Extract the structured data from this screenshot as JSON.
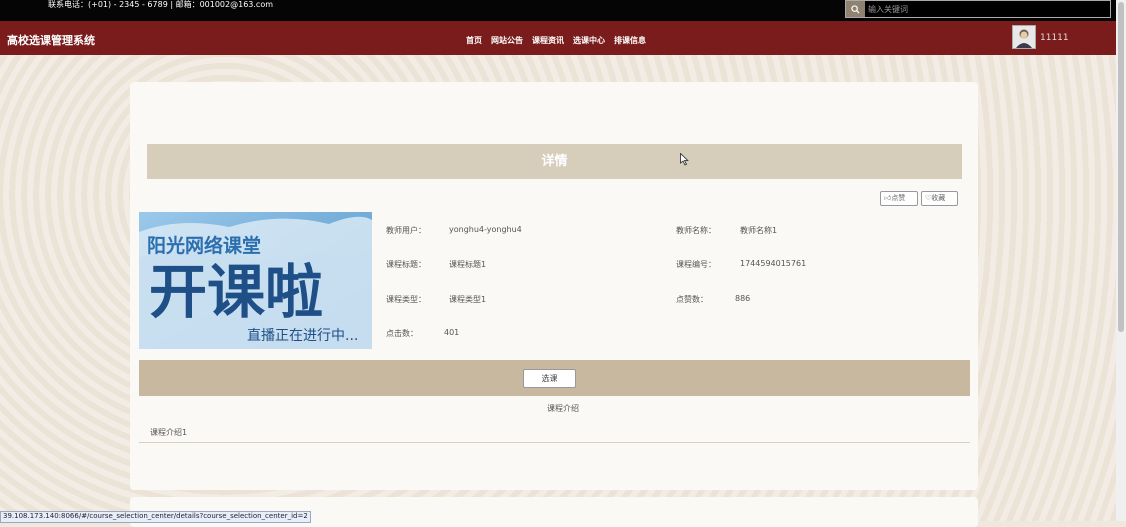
{
  "topbar": {
    "contact": "联系电话：(+01) - 2345 - 6789 | 邮箱：001002@163.com",
    "search_placeholder": "输入关键词"
  },
  "nav": {
    "title": "高校选课管理系统",
    "items": [
      {
        "label": "首页"
      },
      {
        "label": "网站公告"
      },
      {
        "label": "课程资讯"
      },
      {
        "label": "选课中心"
      },
      {
        "label": "排课信息"
      }
    ],
    "user_name": "11111"
  },
  "detail": {
    "title": "详情",
    "like_label": "点赞",
    "favorite_label": "收藏",
    "image": {
      "line1": "阳光网络课堂",
      "line2": "开课啦",
      "line3": "直播正在进行中..."
    },
    "fields": {
      "teacher_user_label": "教师用户：",
      "teacher_user_value": "yonghu4-yonghu4",
      "teacher_name_label": "教师名称：",
      "teacher_name_value": "教师名称1",
      "course_title_label": "课程标题：",
      "course_title_value": "课程标题1",
      "course_no_label": "课程编号：",
      "course_no_value": "1744594015761",
      "course_type_label": "课程类型：",
      "course_type_value": "课程类型1",
      "likes_label": "点赞数：",
      "likes_value": "886",
      "clicks_label": "点击数：",
      "clicks_value": "401"
    },
    "select_button": "选课",
    "intro_heading": "课程介绍",
    "intro_text": "课程介绍1"
  },
  "status_url": "39.108.173.140:8066/#/course_selection_center/details?course_selection_center_id=2",
  "colors": {
    "nav_bg": "#7a1c1c",
    "title_bar": "#d6cdbb",
    "select_bar": "#c8b8a0"
  }
}
